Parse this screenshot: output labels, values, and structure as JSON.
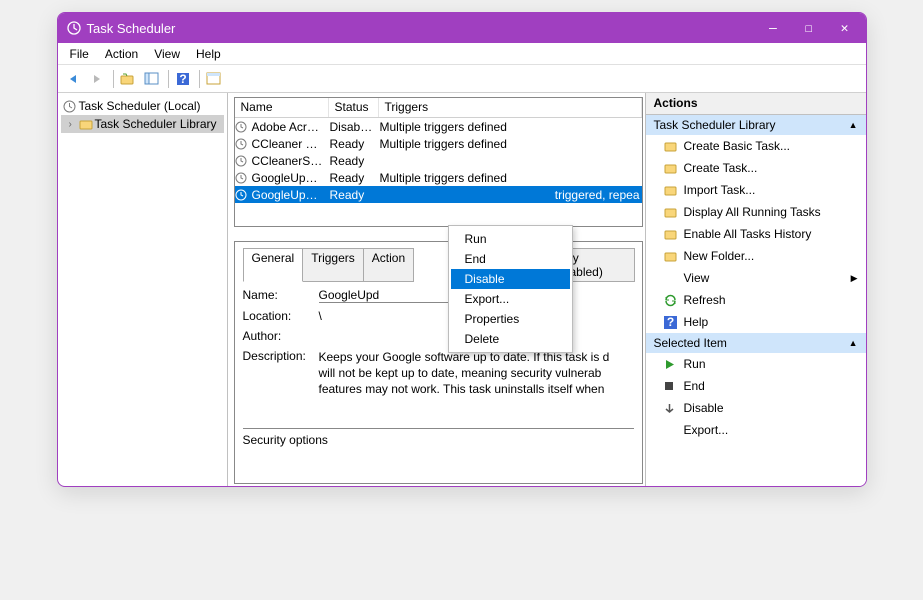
{
  "title": "Task Scheduler",
  "menubar": [
    "File",
    "Action",
    "View",
    "Help"
  ],
  "tree": {
    "root": "Task Scheduler (Local)",
    "child": "Task Scheduler Library"
  },
  "columns": {
    "name": "Name",
    "status": "Status",
    "triggers": "Triggers"
  },
  "tasks": [
    {
      "name": "Adobe Acro...",
      "status": "Disabled",
      "triggers": "Multiple triggers defined"
    },
    {
      "name": "CCleaner Up...",
      "status": "Ready",
      "triggers": "Multiple triggers defined"
    },
    {
      "name": "CCleanerSki...",
      "status": "Ready",
      "triggers": ""
    },
    {
      "name": "GoogleUpda...",
      "status": "Ready",
      "triggers": "Multiple triggers defined"
    },
    {
      "name": "GoogleUpda...",
      "status": "Ready",
      "triggers": "triggered, repea"
    }
  ],
  "context_menu": [
    "Run",
    "End",
    "Disable",
    "Export...",
    "Properties",
    "Delete"
  ],
  "context_highlight": "Disable",
  "details": {
    "tabs": [
      "General",
      "Triggers",
      "Action",
      "istory (disabled)"
    ],
    "tab_active": "General",
    "name_label": "Name:",
    "name_value": "GoogleUpd",
    "location_label": "Location:",
    "location_value": "\\",
    "author_label": "Author:",
    "description_label": "Description:",
    "description_value": "Keeps your Google software up to date. If this task is d\nwill not be kept up to date, meaning security vulnerab\nfeatures may not work. This task uninstalls itself when",
    "security_label": "Security options"
  },
  "actions_header": "Actions",
  "sections": {
    "library": "Task Scheduler Library",
    "selected": "Selected Item"
  },
  "lib_actions": [
    "Create Basic Task...",
    "Create Task...",
    "Import Task...",
    "Display All Running Tasks",
    "Enable All Tasks History",
    "New Folder...",
    "View",
    "Refresh",
    "Help"
  ],
  "sel_actions": [
    "Run",
    "End",
    "Disable",
    "Export..."
  ]
}
